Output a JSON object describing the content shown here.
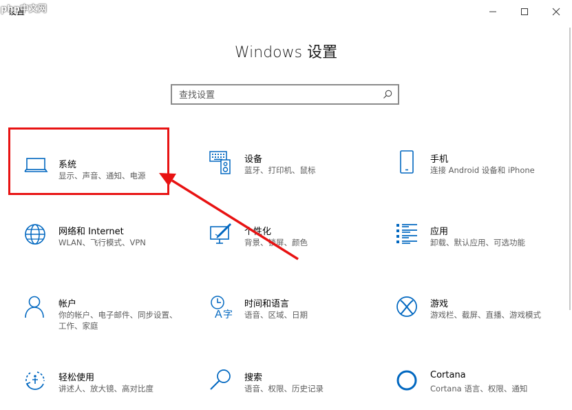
{
  "window": {
    "title": "设置",
    "watermark": "php中文网"
  },
  "header": {
    "title": "Windows 设置"
  },
  "search": {
    "placeholder": "查找设置",
    "value": ""
  },
  "tiles": [
    {
      "title": "系统",
      "desc": "显示、声音、通知、电源",
      "icon": "laptop-icon"
    },
    {
      "title": "设备",
      "desc": "蓝牙、打印机、鼠标",
      "icon": "devices-icon"
    },
    {
      "title": "手机",
      "desc": "连接 Android 设备和 iPhone",
      "icon": "phone-icon"
    },
    {
      "title": "网络和 Internet",
      "desc": "WLAN、飞行模式、VPN",
      "icon": "globe-icon"
    },
    {
      "title": "个性化",
      "desc": "背景、锁屏、颜色",
      "icon": "personalization-icon"
    },
    {
      "title": "应用",
      "desc": "卸载、默认应用、可选功能",
      "icon": "apps-list-icon"
    },
    {
      "title": "帐户",
      "desc": "你的帐户、电子邮件、同步设置、工作、家庭",
      "icon": "person-icon"
    },
    {
      "title": "时间和语言",
      "desc": "语音、区域、日期",
      "icon": "time-language-icon"
    },
    {
      "title": "游戏",
      "desc": "游戏栏、截屏、直播、游戏模式",
      "icon": "xbox-icon"
    },
    {
      "title": "轻松使用",
      "desc": "讲述人、放大镜、高对比度",
      "icon": "ease-of-access-icon"
    },
    {
      "title": "搜索",
      "desc": "语音、权限、历史记录",
      "icon": "search-category-icon"
    },
    {
      "title": "Cortana",
      "desc": "Cortana 语言、权限、通知",
      "icon": "cortana-icon"
    }
  ],
  "colors": {
    "accent": "#0067c0",
    "annotation": "#e81212"
  }
}
